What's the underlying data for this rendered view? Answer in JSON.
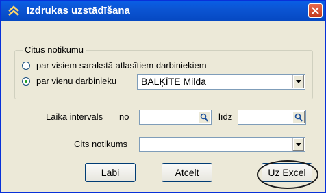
{
  "window": {
    "title": "Izdrukas uzstādīšana",
    "title_icon": "double-chevron-up-icon",
    "close_icon": "close-icon"
  },
  "group": {
    "legend": "Citus notikumu",
    "options": [
      {
        "label": "par visiem sarakstā atlasītiem darbiniekiem",
        "selected": false
      },
      {
        "label": "par vienu darbinieku",
        "selected": true
      }
    ],
    "employee_value": "BALĶĪTE Milda"
  },
  "interval": {
    "label": "Laika intervāls",
    "from_label": "no",
    "from_value": "",
    "to_label": "līdz",
    "to_value": ""
  },
  "other_event": {
    "label": "Cits notikums",
    "value": ""
  },
  "buttons": {
    "ok": "Labi",
    "cancel": "Atcelt",
    "excel": "Uz Excel"
  },
  "colors": {
    "titlebar": "#0a5fe6",
    "dialog_bg": "#ece9d8",
    "close": "#c2391d",
    "radio_dot": "#21a121"
  }
}
